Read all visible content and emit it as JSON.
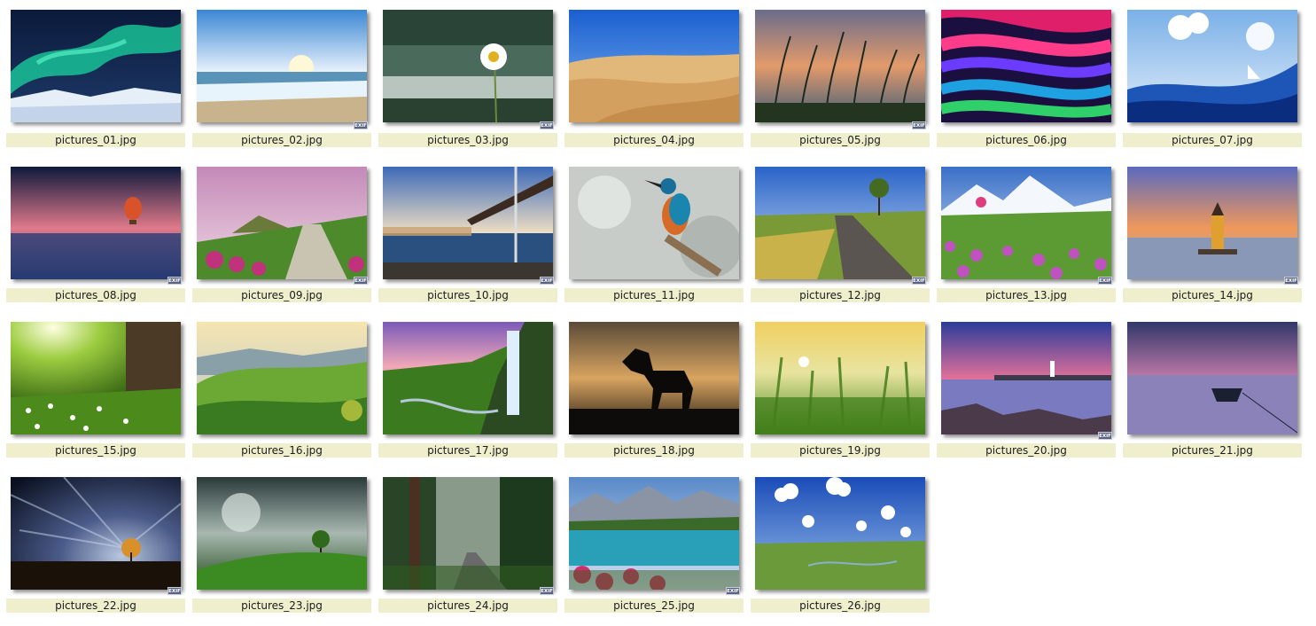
{
  "exif_badge": "EXIF",
  "files": [
    {
      "name": "pictures_01.jpg",
      "scene": "aurora",
      "exif": false
    },
    {
      "name": "pictures_02.jpg",
      "scene": "beach",
      "exif": true
    },
    {
      "name": "pictures_03.jpg",
      "scene": "daisy",
      "exif": true
    },
    {
      "name": "pictures_04.jpg",
      "scene": "desert",
      "exif": false
    },
    {
      "name": "pictures_05.jpg",
      "scene": "grass-sunset",
      "exif": true
    },
    {
      "name": "pictures_06.jpg",
      "scene": "abstract-waves",
      "exif": false
    },
    {
      "name": "pictures_07.jpg",
      "scene": "sailboat-sky",
      "exif": false
    },
    {
      "name": "pictures_08.jpg",
      "scene": "balloon",
      "exif": true
    },
    {
      "name": "pictures_09.jpg",
      "scene": "flower-path",
      "exif": true
    },
    {
      "name": "pictures_10.jpg",
      "scene": "bridge",
      "exif": true
    },
    {
      "name": "pictures_11.jpg",
      "scene": "kingfisher",
      "exif": false
    },
    {
      "name": "pictures_12.jpg",
      "scene": "country-road",
      "exif": true
    },
    {
      "name": "pictures_13.jpg",
      "scene": "mountain-flowers",
      "exif": true
    },
    {
      "name": "pictures_14.jpg",
      "scene": "maiden-tower",
      "exif": true
    },
    {
      "name": "pictures_15.jpg",
      "scene": "meadow-sun",
      "exif": false
    },
    {
      "name": "pictures_16.jpg",
      "scene": "green-hills",
      "exif": false
    },
    {
      "name": "pictures_17.jpg",
      "scene": "waterfall",
      "exif": false
    },
    {
      "name": "pictures_18.jpg",
      "scene": "horse",
      "exif": false
    },
    {
      "name": "pictures_19.jpg",
      "scene": "wheat",
      "exif": false
    },
    {
      "name": "pictures_20.jpg",
      "scene": "lighthouse",
      "exif": true
    },
    {
      "name": "pictures_21.jpg",
      "scene": "boat-dusk",
      "exif": false
    },
    {
      "name": "pictures_22.jpg",
      "scene": "lone-tree-night",
      "exif": true
    },
    {
      "name": "pictures_23.jpg",
      "scene": "tree-hill-storm",
      "exif": false
    },
    {
      "name": "pictures_24.jpg",
      "scene": "forest-road",
      "exif": true
    },
    {
      "name": "pictures_25.jpg",
      "scene": "alpine-lake",
      "exif": true
    },
    {
      "name": "pictures_26.jpg",
      "scene": "plains-clouds",
      "exif": false
    }
  ]
}
